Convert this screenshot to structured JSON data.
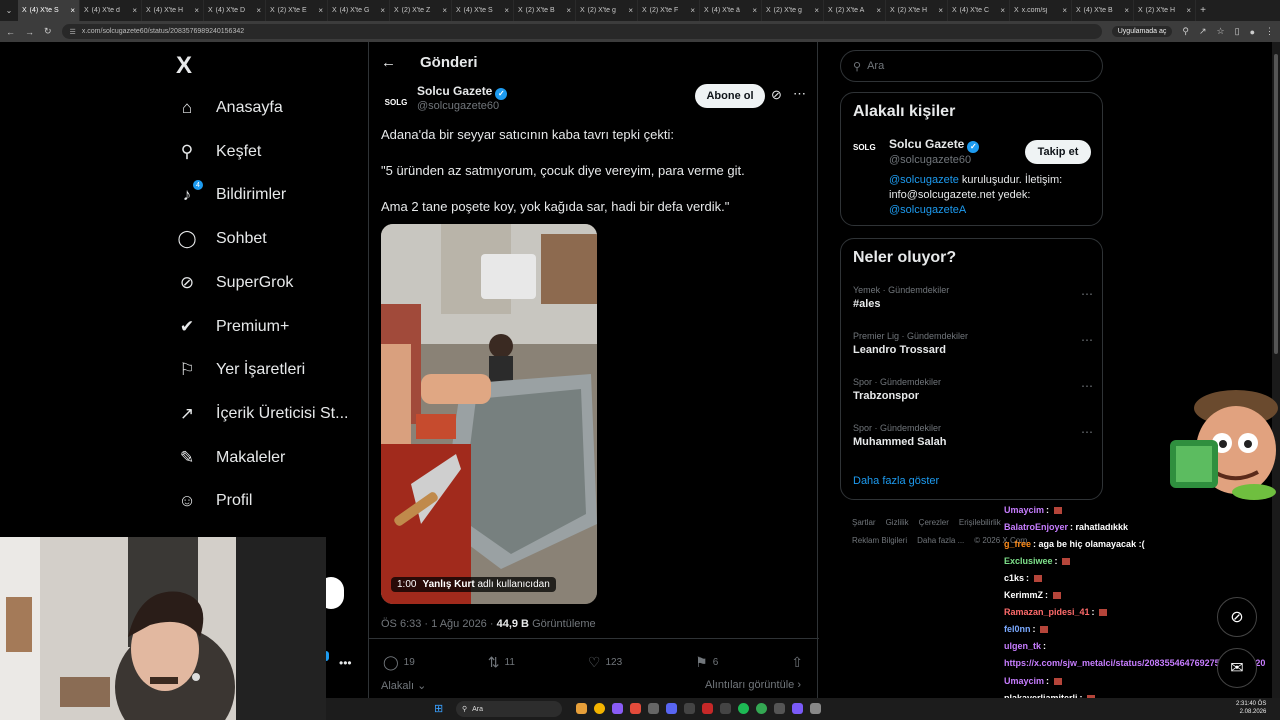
{
  "browser": {
    "tabs": [
      {
        "label": "(4) X'te S",
        "active": true
      },
      {
        "label": "(4) X'te d"
      },
      {
        "label": "(4) X'te H"
      },
      {
        "label": "(4) X'te D"
      },
      {
        "label": "(2) X'te E"
      },
      {
        "label": "(4) X'te G"
      },
      {
        "label": "(2) X'te Z"
      },
      {
        "label": "(4) X'te S"
      },
      {
        "label": "(2) X'te B"
      },
      {
        "label": "(2) X'te g"
      },
      {
        "label": "(2) X'te F"
      },
      {
        "label": "(4) X'te â"
      },
      {
        "label": "(2) X'te g"
      },
      {
        "label": "(2) X'te A"
      },
      {
        "label": "(2) X'te H"
      },
      {
        "label": "(4) X'te C"
      },
      {
        "label": "x.com/sj"
      },
      {
        "label": "(4) X'te B"
      },
      {
        "label": "(2) X'te H"
      }
    ],
    "url": "x.com/solcugazete60/status/2083576989240156342",
    "app_button": "Uygulamada aç"
  },
  "nav": {
    "logo": "X",
    "notification_count": "4",
    "items": [
      {
        "label": "Anasayfa",
        "icon": "home-icon",
        "glyph": "⌂"
      },
      {
        "label": "Keşfet",
        "icon": "search-icon",
        "glyph": "⚲"
      },
      {
        "label": "Bildirimler",
        "icon": "bell-icon",
        "glyph": "♪"
      },
      {
        "label": "Sohbet",
        "icon": "chat-icon",
        "glyph": "◯"
      },
      {
        "label": "SuperGrok",
        "icon": "grok-icon",
        "glyph": "⊘"
      },
      {
        "label": "Premium+",
        "icon": "premium-icon",
        "glyph": "✔"
      },
      {
        "label": "Yer İşaretleri",
        "icon": "bookmark-icon",
        "glyph": "⚐"
      },
      {
        "label": "İçerik Üreticisi St...",
        "icon": "rocket-icon",
        "glyph": "↗"
      },
      {
        "label": "Makaleler",
        "icon": "articles-icon",
        "glyph": "✎"
      },
      {
        "label": "Profil",
        "icon": "profile-icon",
        "glyph": "☺"
      }
    ],
    "more_glyph": "•••"
  },
  "post": {
    "header_title": "Gönderi",
    "author_avatar": "SOLG",
    "author_name": "Solcu Gazete",
    "author_handle": "@solcugazete60",
    "subscribe_label": "Abone ol",
    "text": [
      "Adana'da bir seyyar satıcının kaba tavrı tepki çekti:",
      "\"5 üründen az satmıyorum, çocuk diye vereyim, para verme git.",
      "Ama 2 tane poşete koy, yok kağıda sar, hadi bir defa verdik.\""
    ],
    "video_duration": "1:00",
    "video_credit_name": "Yanlış Kurt",
    "video_credit_suffix": "adlı kullanıcıdan",
    "time": "ÖS 6:33 · 1 Ağu 2026 ·",
    "views": "44,9 B",
    "views_label": "Görüntüleme",
    "replies": "19",
    "reposts": "11",
    "likes": "123",
    "bookmarks": "6",
    "sort_label": "Alakalı",
    "view_quotes": "Alıntıları görüntüle"
  },
  "right": {
    "search_placeholder": "Ara",
    "relevant_title": "Alakalı kişiler",
    "rp_avatar": "SOLG",
    "rp_name": "Solcu Gazete",
    "rp_handle": "@solcugazete60",
    "follow_label": "Takip et",
    "bio_link1": "@solcugazete",
    "bio_text": " kuruluşudur. İletişim: info@solcugazete.net yedek: ",
    "bio_link2": "@solcugazeteA",
    "trends_title": "Neler oluyor?",
    "trends": [
      {
        "context": "Yemek · Gündemdekiler",
        "name": "#ales"
      },
      {
        "context": "Premier Lig · Gündemdekiler",
        "name": "Leandro Trossard"
      },
      {
        "context": "Spor · Gündemdekiler",
        "name": "Trabzonspor"
      },
      {
        "context": "Spor · Gündemdekiler",
        "name": "Muhammed Salah"
      }
    ],
    "show_more": "Daha fazla göster",
    "footer": [
      "Şartlar",
      "Gizlilik",
      "Çerezler",
      "Erişilebilirlik",
      "Reklam Bilgileri",
      "Daha fazla ...",
      "© 2026 X Corp."
    ]
  },
  "chat": [
    {
      "user": "Umaycim",
      "msg": "",
      "color": "#c77dff",
      "emote": true
    },
    {
      "user": "BalatroEnjoyer",
      "msg": "rahatladıkkk",
      "color": "#c77dff",
      "emote": false
    },
    {
      "user": "g_free",
      "msg": "aga be hiç olamayacak :(",
      "color": "#ff8c1a",
      "emote": false
    },
    {
      "user": "Exclusiwee",
      "msg": "",
      "color": "#7ee08a",
      "emote": true
    },
    {
      "user": "c1ks",
      "msg": "",
      "color": "#ffffff",
      "emote": true
    },
    {
      "user": "KerimmZ",
      "msg": "",
      "color": "#ffffff",
      "emote": true
    },
    {
      "user": "Ramazan_pidesi_41",
      "msg": "",
      "color": "#ff6b6b",
      "emote": true
    },
    {
      "user": "fel0nn",
      "msg": "",
      "color": "#7aa9ff",
      "emote": true
    },
    {
      "user": "ulgen_tk",
      "msg": "",
      "color": "#c77dff",
      "emote": false
    },
    {
      "user": "",
      "msg": "https://x.com/sjw_metalci/status/2083554647692750957?s=20",
      "color": "#c77dff",
      "emote": false,
      "link": true
    },
    {
      "user": "Umaycim",
      "msg": "",
      "color": "#c77dff",
      "emote": true
    },
    {
      "user": "plakayerliamiterli",
      "msg": "",
      "color": "#ffffff",
      "emote": true
    }
  ],
  "taskbar": {
    "search": "Ara",
    "time": "2:31:40 ÖS",
    "date": "2.08.2026"
  },
  "colors": {
    "accent": "#1d9bf0",
    "background": "#000000",
    "border": "#2f3336"
  }
}
